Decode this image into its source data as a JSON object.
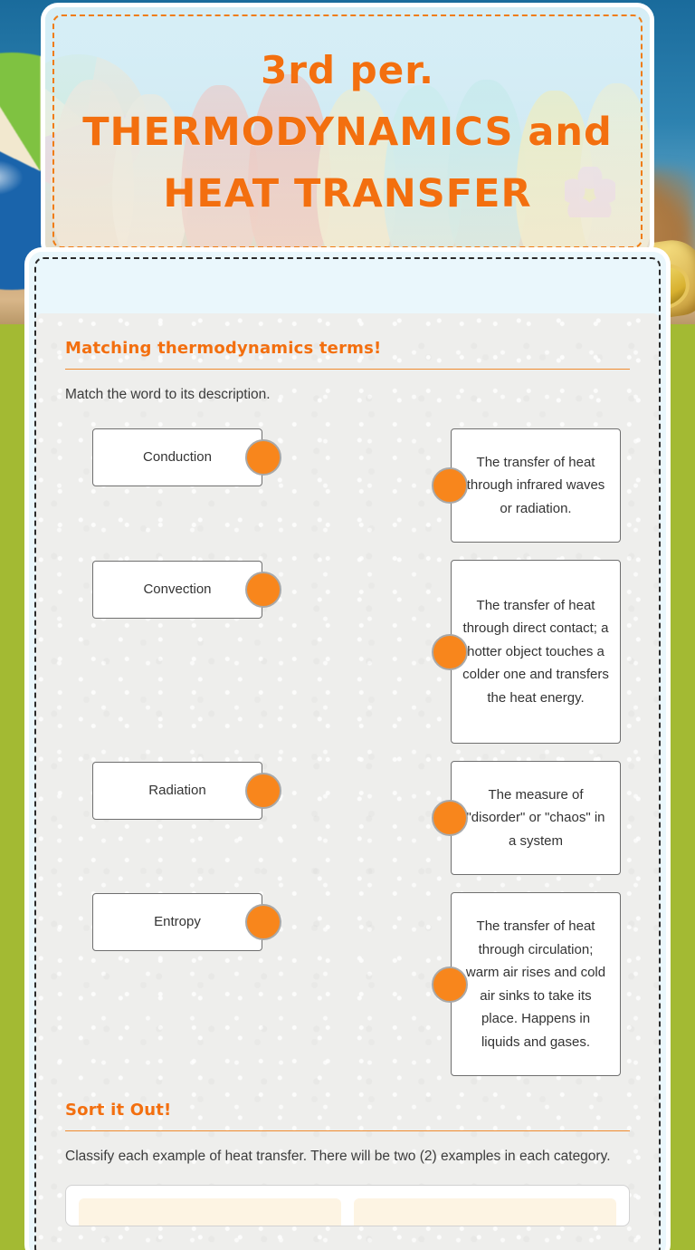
{
  "worksheet": {
    "title_lines": [
      "3rd per.",
      "THERMODYNAMICS and",
      "HEAT TRANSFER"
    ],
    "accent_color": "#f36f0f",
    "dot_color": "#f8861c"
  },
  "matching_section": {
    "heading": "Matching thermodynamics terms!",
    "instructions": "Match the word to its description.",
    "terms": [
      {
        "label": "Conduction"
      },
      {
        "label": "Convection"
      },
      {
        "label": "Radiation"
      },
      {
        "label": "Entropy"
      }
    ],
    "descriptions": [
      {
        "label": "The transfer of heat through infrared waves or radiation."
      },
      {
        "label": "The transfer of heat through direct contact; a hotter object touches a colder one and transfers the heat energy."
      },
      {
        "label": "The measure of \"disorder\" or \"chaos\" in a system"
      },
      {
        "label": "The transfer of heat through circulation; warm air rises and cold air sinks to take its place. Happens in liquids and gases."
      }
    ]
  },
  "sort_section": {
    "heading": "Sort it Out!",
    "instructions": "Classify each example of heat transfer. There will be two (2) examples in each category."
  }
}
